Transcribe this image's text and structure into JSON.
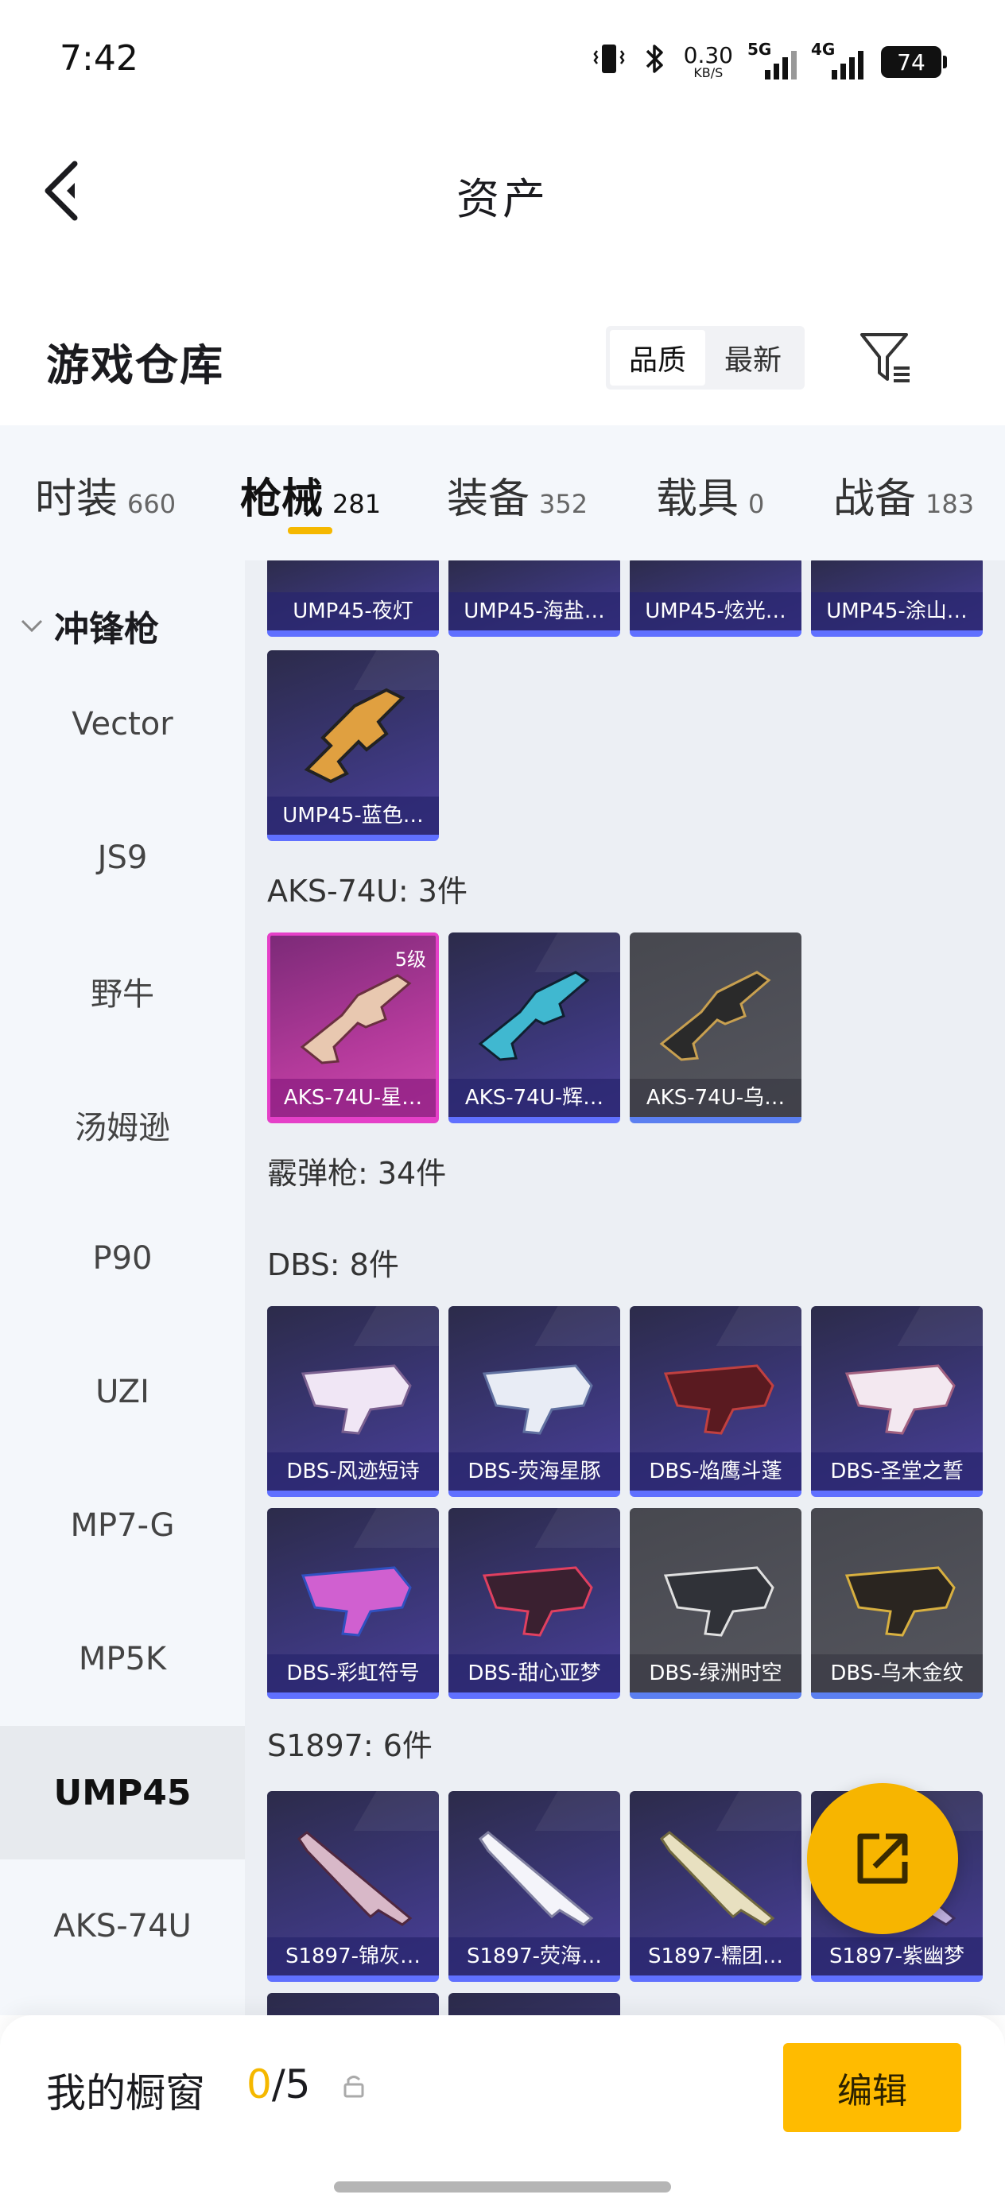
{
  "status_bar": {
    "time": "7:42",
    "net_speed_value": "0.30",
    "net_speed_unit": "KB/S",
    "signal_1": "5G",
    "signal_2": "4G",
    "battery": "74"
  },
  "header": {
    "title": "资产"
  },
  "section": {
    "title": "游戏仓库",
    "sort_options": [
      "品质",
      "最新"
    ],
    "active_sort": "品质"
  },
  "tabs": [
    {
      "name": "时装",
      "count": "660"
    },
    {
      "name": "枪械",
      "count": "281",
      "active": true
    },
    {
      "name": "装备",
      "count": "352"
    },
    {
      "name": "载具",
      "count": "0"
    },
    {
      "name": "战备",
      "count": "183"
    }
  ],
  "sidebar": {
    "group": "冲锋枪",
    "items": [
      "Vector",
      "JS9",
      "野牛",
      "汤姆逊",
      "P90",
      "UZI",
      "MP7-G",
      "MP5K",
      "UMP45",
      "AKS-74U"
    ],
    "active": "UMP45"
  },
  "content": {
    "ump_top_row": [
      "UMP45-夜灯",
      "UMP45-海盐…",
      "UMP45-炫光…",
      "UMP45-涂山…"
    ],
    "ump_single": "UMP45-蓝色…",
    "aks_header": "AKS-74U: 3件",
    "aks_items": [
      {
        "label": "AKS-74U-星…",
        "level": "5级"
      },
      {
        "label": "AKS-74U-辉…"
      },
      {
        "label": "AKS-74U-乌…"
      }
    ],
    "shotgun_header": "霰弹枪: 34件",
    "dbs_header": "DBS: 8件",
    "dbs_items": [
      "DBS-风迹短诗",
      "DBS-荧海星豚",
      "DBS-焰鹰斗蓬",
      "DBS-圣堂之誓",
      "DBS-彩虹符号",
      "DBS-甜心亚梦",
      "DBS-绿洲时空",
      "DBS-乌木金纹"
    ],
    "s1897_header": "S1897: 6件",
    "s1897_items": [
      "S1897-锦灰…",
      "S1897-荧海…",
      "S1897-糯团…",
      "S1897-紫幽梦"
    ]
  },
  "bottom": {
    "window_title": "我的橱窗",
    "count_current": "0",
    "count_total": "/5",
    "edit_label": "编辑"
  },
  "colors": {
    "accent": "#f5b800",
    "edit_button": "#ffbb00",
    "card_purple": "#3a3676",
    "card_pink": "#b43a9b",
    "card_grey": "#55565e"
  }
}
